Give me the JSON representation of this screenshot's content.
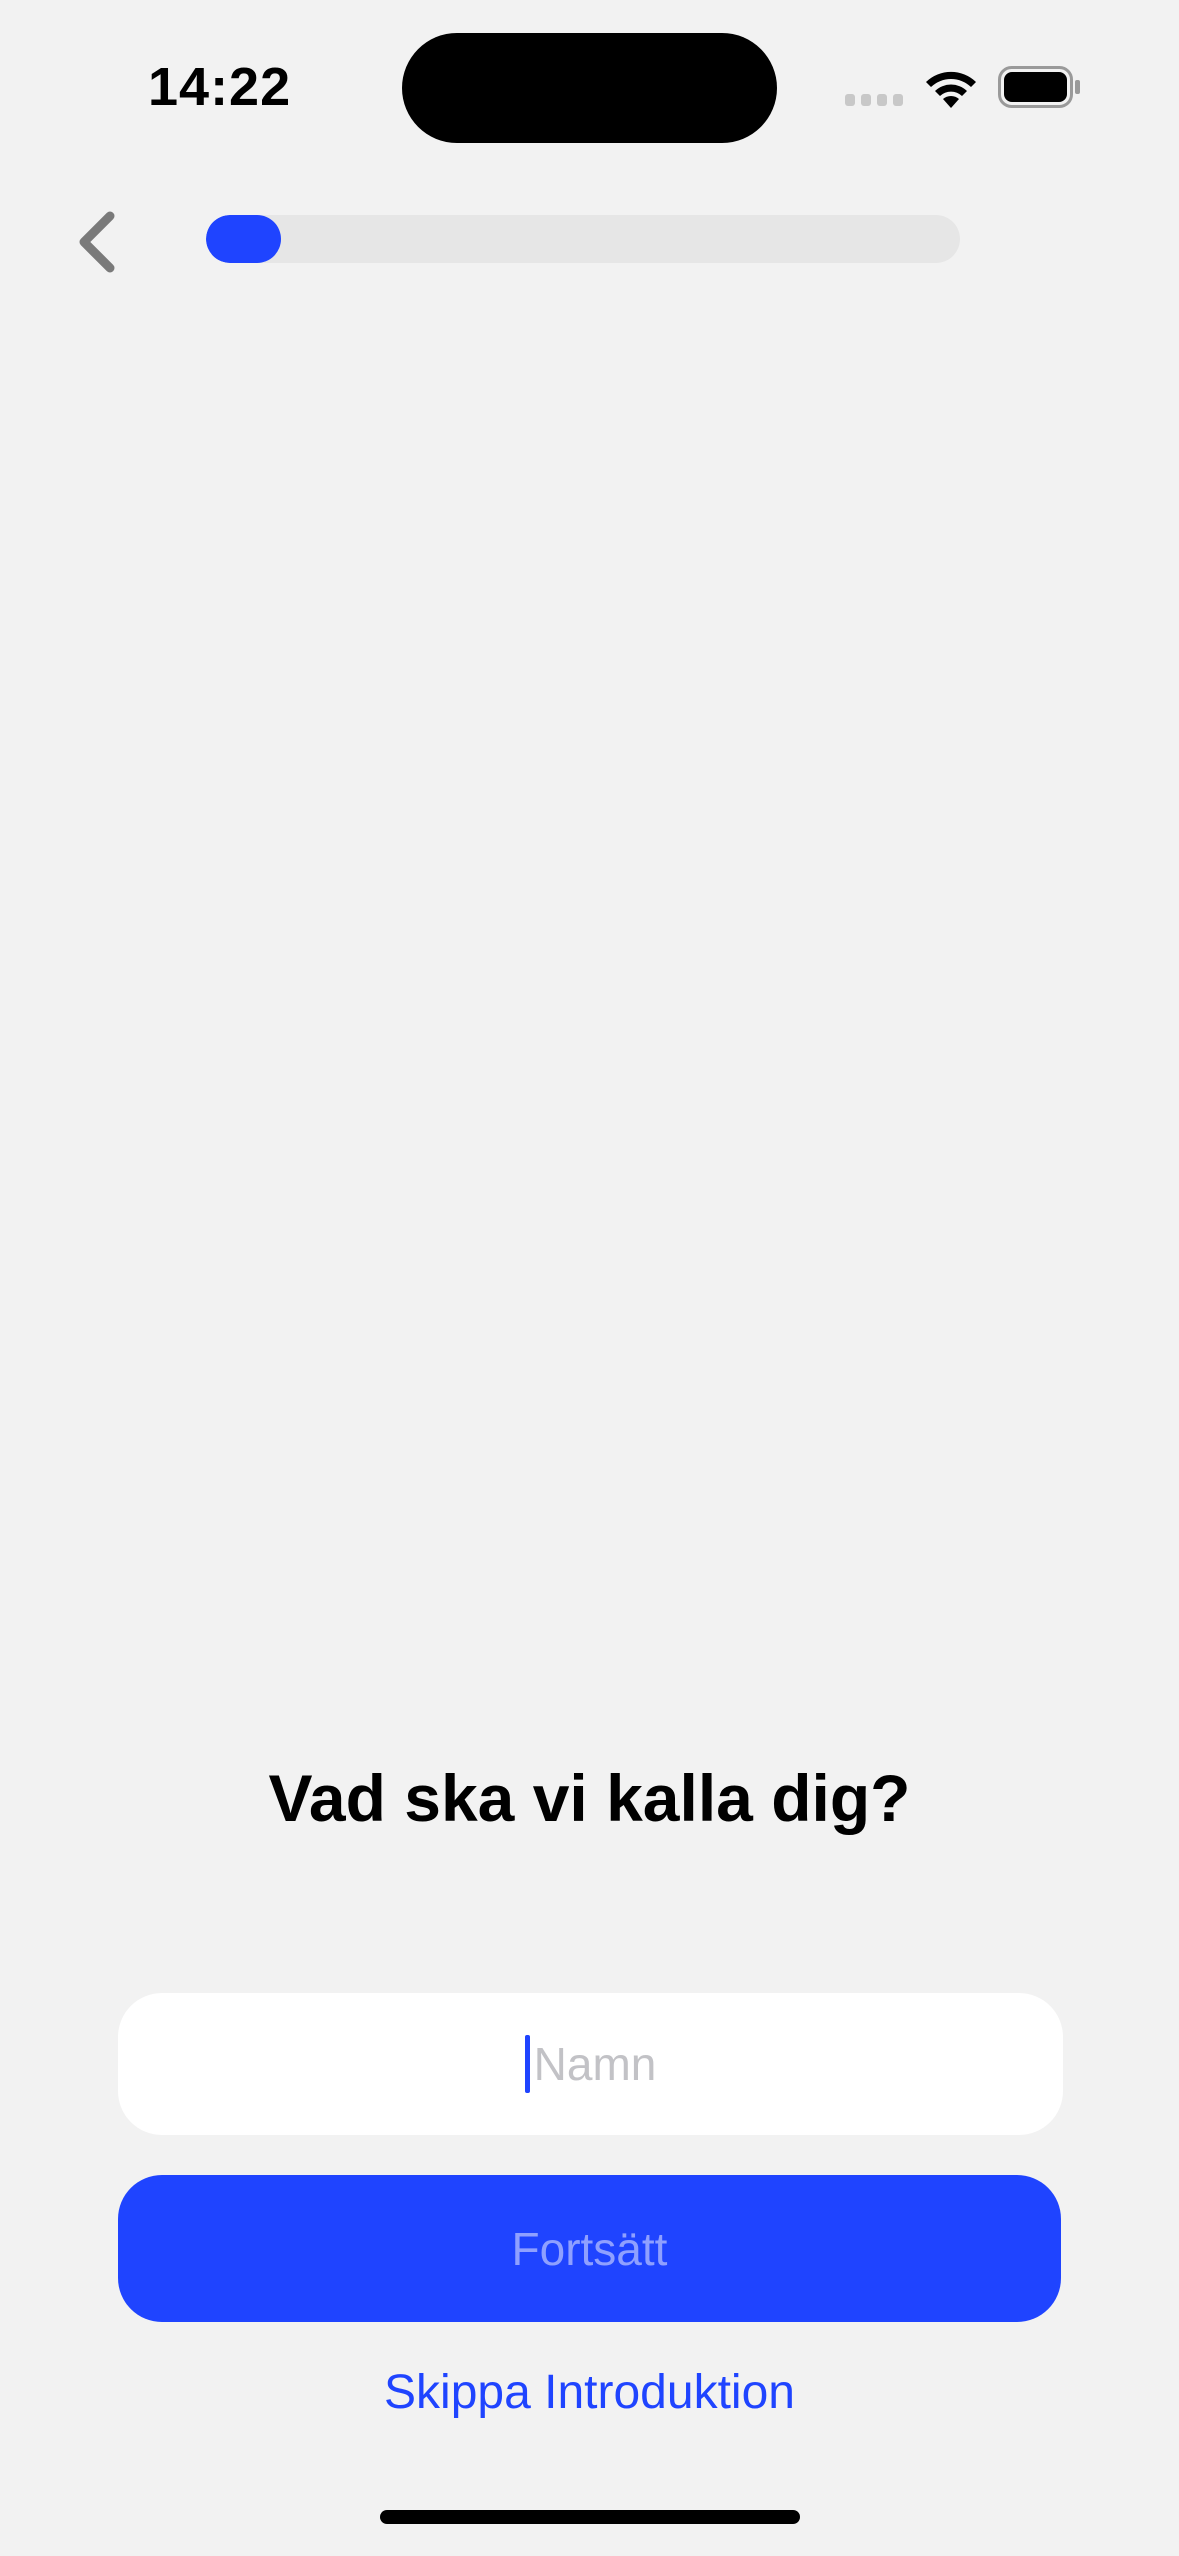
{
  "status_bar": {
    "time": "14:22",
    "icons": [
      "signal-icon",
      "wifi-icon",
      "battery-icon"
    ]
  },
  "nav": {
    "back_icon": "chevron-left-icon",
    "progress_fraction": 0.1
  },
  "heading": "Vad ska vi kalla dig?",
  "name_input": {
    "placeholder": "Namn",
    "value": ""
  },
  "continue_button": {
    "label": "Fortsätt",
    "enabled": false
  },
  "skip_link": "Skippa Introduktion",
  "colors": {
    "accent": "#1f44ff",
    "background": "#f2f2f2",
    "track": "#e6e6e6",
    "disabled_label": "#8fa0ff"
  }
}
